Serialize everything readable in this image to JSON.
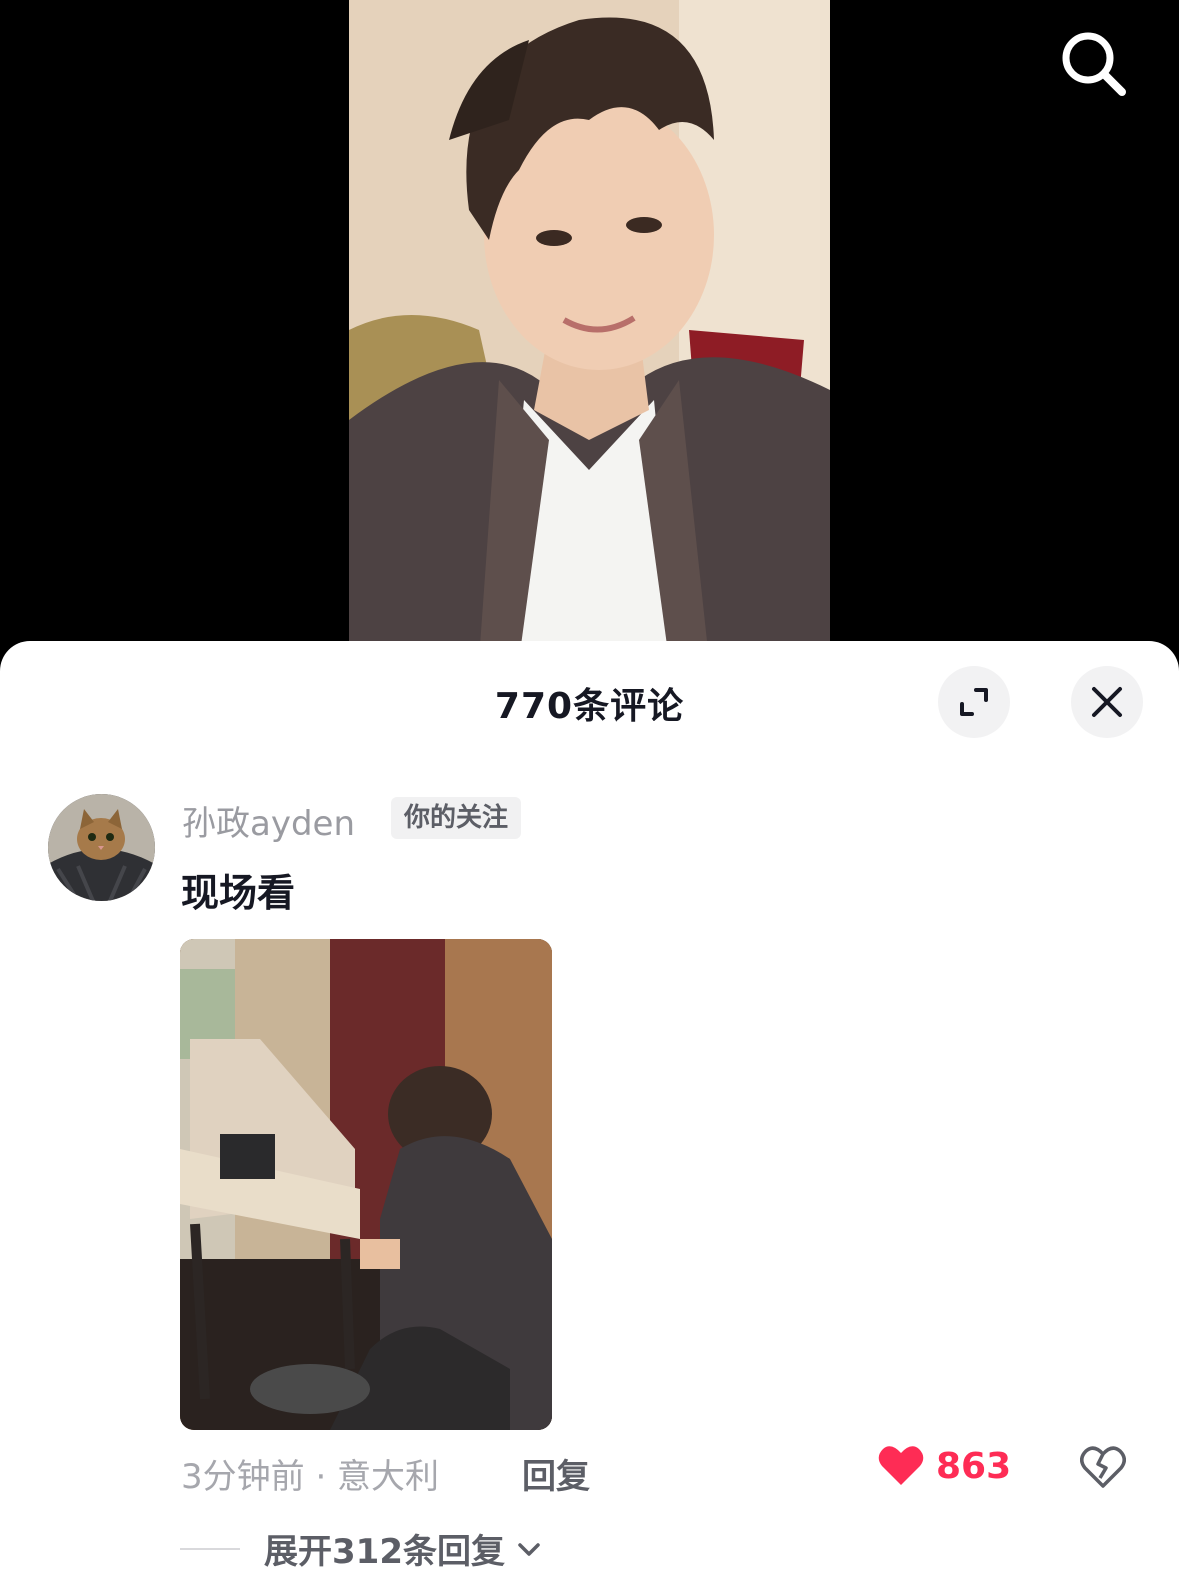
{
  "sheet": {
    "title": "770条评论"
  },
  "comment": {
    "username": "孙政ayden",
    "badge": "你的关注",
    "text": "现场看",
    "time_location": "3分钟前 · 意大利",
    "reply_label": "回复",
    "like_count": "863",
    "expand_label": "展开312条回复"
  },
  "icons": {
    "search": "search-icon",
    "expand": "expand-icon",
    "close": "close-icon",
    "like": "heart-icon",
    "dislike": "broken-heart-icon",
    "chevron": "chevron-down-icon"
  },
  "colors": {
    "accent_like": "#fe2c55",
    "title": "#161823",
    "secondary": "#9a9ba1"
  }
}
